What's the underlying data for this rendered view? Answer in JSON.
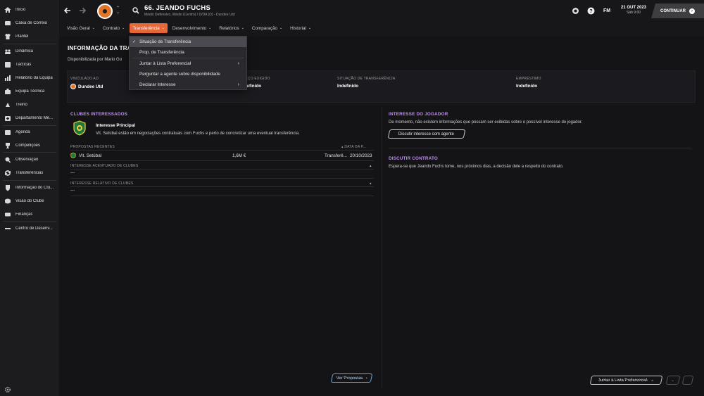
{
  "sidebar": {
    "items": [
      {
        "label": "Início",
        "icon": "home-icon"
      },
      {
        "label": "Caixa de Correio",
        "icon": "mail-icon"
      },
      {
        "label": "Plantel",
        "icon": "shirt-icon"
      },
      {
        "label": "Dinâmica",
        "icon": "dynamics-icon"
      },
      {
        "label": "Tácticas",
        "icon": "tactics-icon"
      },
      {
        "label": "Relatório da Equipa",
        "icon": "report-icon"
      },
      {
        "label": "Equipa Técnica",
        "icon": "staff-icon"
      },
      {
        "label": "Treino",
        "icon": "training-icon"
      },
      {
        "label": "Departamento Mé...",
        "icon": "medical-icon"
      },
      {
        "label": "Agenda",
        "icon": "calendar-icon"
      },
      {
        "label": "Competições",
        "icon": "trophy-icon"
      },
      {
        "label": "Observação",
        "icon": "scouting-icon"
      },
      {
        "label": "Transferências",
        "icon": "transfers-icon"
      },
      {
        "label": "Informação do Clu...",
        "icon": "club-info-icon"
      },
      {
        "label": "Visão do Clube",
        "icon": "club-vision-icon"
      },
      {
        "label": "Finanças",
        "icon": "finances-icon"
      },
      {
        "label": "Centro de Desenv...",
        "icon": "development-icon"
      }
    ]
  },
  "header": {
    "player_name": "66. JEANDO FUCHS",
    "player_sub": "Médio Defensivo, Médio (Centro) / D/DA (D) - Dundee Utd",
    "tabs": [
      {
        "label": "Visão Geral"
      },
      {
        "label": "Contrato"
      },
      {
        "label": "Transferência"
      },
      {
        "label": "Desenvolvimento"
      },
      {
        "label": "Relatórios"
      },
      {
        "label": "Comparação"
      },
      {
        "label": "Historial"
      }
    ],
    "fm_label": "FM",
    "date": "21 OUT 2023",
    "time": "Sáb 9:00",
    "continue_label": "CONTINUAR"
  },
  "dropdown": {
    "items": [
      {
        "label": "Situação de Transferência",
        "selected": true
      },
      {
        "label": "Prop. de Transferência"
      },
      {
        "label": "Juntar à Lista Preferencial",
        "submenu": true
      },
      {
        "label": "Perguntar a agente sobre disponibilidade"
      },
      {
        "label": "Declarar Interesse",
        "submenu": true
      }
    ]
  },
  "main": {
    "title": "INFORMAÇÃO DA TRANSFERÊNCIA",
    "availability": "Disponibilizada por Mario Go",
    "info": {
      "linked_label": "VINCULADO AO",
      "linked_value": "Dundee Utd",
      "price_label": "PREÇO EXIGIDO",
      "price_value": "Indefinido",
      "status_label": "SITUAÇÃO DE TRANSFERÊNCIA",
      "status_value": "Indefinido",
      "loan_label": "EMPRÉSTIMO",
      "loan_value": "Indefinido"
    },
    "interested": {
      "title": "CLUBES INTERESSADOS",
      "main_interest_title": "Interesse Principal",
      "main_interest_text": "Vit. Setúbal estão em negociações contratuais com Fuchs e perto de concretizar uma eventual transferência.",
      "recent_label": "PROPOSTAS RECENTES",
      "date_col": "DATA DA P...",
      "offers": [
        {
          "club": "Vit. Setúbal",
          "value": "1,6M €",
          "type": "Transferê...",
          "date": "20/10/2023"
        }
      ],
      "sharp_label": "INTERESSE ACENTUADO DE CLUBES",
      "sharp_value": "---",
      "relative_label": "INTERESSE RELATIVO DE CLUBES",
      "relative_value": "---",
      "view_offers_label": "Ver Propostas"
    },
    "player_interest": {
      "title": "INTERESSE DO JOGADOR",
      "text": "De momento, não existem informações que possam ser exibidas sobre o possível interesse do jogador.",
      "button": "Discutir interesse com agente"
    },
    "contract": {
      "title": "DISCUTIR CONTRATO",
      "text": "Espera-se que Jeando Fuchs tome, nos próximos dias, a decisão dele a respeito do contrato."
    },
    "shortlist_button": "Juntar à Lista Preferencial"
  },
  "colors": {
    "accent": "#e8683a",
    "section_purple": "#c18cf2",
    "continue_bg": "#3d3d42"
  }
}
